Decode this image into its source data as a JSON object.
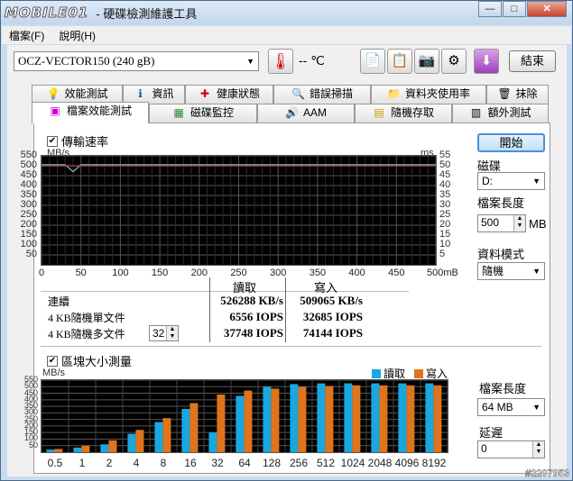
{
  "app": {
    "logo": "MOBILE01",
    "title": "- 硬碟檢測維護工具"
  },
  "window_buttons": {
    "minimize": "—",
    "maximize": "□",
    "close": "✕"
  },
  "menu": [
    {
      "label": "檔案(F)"
    },
    {
      "label": "說明(H)"
    }
  ],
  "toolbar": {
    "drive": "OCZ-VECTOR150 (240 gB)",
    "temperature": "-- ℃",
    "exit_label": "結束"
  },
  "tabs_row1": [
    {
      "label": "效能測試",
      "icon": "lightbulb-icon"
    },
    {
      "label": "資訊",
      "icon": "info-icon"
    },
    {
      "label": "健康狀態",
      "icon": "health-cross-icon"
    },
    {
      "label": "錯誤掃描",
      "icon": "magnifier-icon"
    },
    {
      "label": "資料夾使用率",
      "icon": "folder-icon"
    },
    {
      "label": "抹除",
      "icon": "trash-icon"
    }
  ],
  "tabs_row2": [
    {
      "label": "檔案效能測試",
      "icon": "file-benchmark-icon",
      "active": true
    },
    {
      "label": "磁碟監控",
      "icon": "monitor-icon"
    },
    {
      "label": "AAM",
      "icon": "speaker-icon"
    },
    {
      "label": "隨機存取",
      "icon": "random-access-icon"
    },
    {
      "label": "額外測試",
      "icon": "extra-test-icon"
    }
  ],
  "transfer": {
    "checkbox_label": "傳輸速率",
    "left_unit": "MB/s",
    "right_unit": "ms",
    "y_ticks": [
      "550",
      "500",
      "450",
      "400",
      "350",
      "300",
      "250",
      "200",
      "150",
      "100",
      "50"
    ],
    "y_ticks_right": [
      "55",
      "50",
      "45",
      "40",
      "35",
      "30",
      "25",
      "20",
      "15",
      "10",
      "5"
    ],
    "x_ticks": [
      "0",
      "50",
      "100",
      "150",
      "200",
      "250",
      "300",
      "350",
      "400",
      "450",
      "500mB"
    ]
  },
  "results": {
    "col_read": "讀取",
    "col_write": "寫入",
    "rows": [
      {
        "label": "連續",
        "read": "526288 KB/s",
        "write": "509065 KB/s"
      },
      {
        "label": "4 KB隨機單文件",
        "read": "6556 IOPS",
        "write": "32685 IOPS"
      },
      {
        "label": "4 KB隨機多文件",
        "read": "37748 IOPS",
        "write": "74144 IOPS"
      }
    ],
    "queue_depth": "32"
  },
  "block": {
    "checkbox_label": "區塊大小測量",
    "unit": "MB/s",
    "legend_read": "讀取",
    "legend_write": "寫入"
  },
  "side": {
    "start_label": "開始",
    "disk_label": "磁碟",
    "disk_value": "D:",
    "file_length_label": "檔案長度",
    "file_length_value": "500",
    "file_length_unit": "MB",
    "data_mode_label": "資料模式",
    "data_mode_value": "隨機",
    "block_file_length_label": "檔案長度",
    "block_file_length_value": "64 MB",
    "delay_label": "延遲",
    "delay_value": "0"
  },
  "watermark": "#2207953",
  "colors": {
    "read": "#1aa7e0",
    "write": "#e0741a",
    "line_read": "#7fb2d9",
    "line_write": "#c04040"
  },
  "chart_data": [
    {
      "type": "line",
      "title": "傳輸速率",
      "xlabel": "mB",
      "ylabel": "MB/s",
      "xlim": [
        0,
        500
      ],
      "ylim": [
        0,
        550
      ],
      "series": [
        {
          "name": "讀取",
          "values": [
            505,
            505,
            505,
            505,
            470,
            505,
            505,
            505,
            505,
            505,
            505,
            505,
            505,
            505,
            505,
            505,
            505,
            505,
            505,
            505,
            505,
            505,
            505,
            505,
            505,
            505,
            505,
            505,
            505,
            505,
            505,
            505,
            505,
            505,
            505,
            505,
            505,
            505,
            505,
            505,
            505,
            505,
            505,
            505,
            505,
            505,
            505,
            505,
            505,
            505,
            505
          ]
        },
        {
          "name": "寫入",
          "values": [
            500,
            500,
            500,
            500,
            500,
            500,
            500,
            500,
            500,
            500,
            500,
            500,
            500,
            500,
            500,
            500,
            500,
            500,
            500,
            500,
            500,
            500,
            500,
            500,
            500,
            500,
            500,
            500,
            500,
            500,
            500,
            500,
            500,
            500,
            500,
            500,
            500,
            500,
            500,
            500,
            500,
            500,
            500,
            500,
            500,
            500,
            500,
            500,
            500,
            500,
            500
          ]
        }
      ]
    },
    {
      "type": "bar",
      "title": "區塊大小測量",
      "ylabel": "MB/s",
      "ylim": [
        0,
        550
      ],
      "categories": [
        "0.5",
        "1",
        "2",
        "4",
        "8",
        "16",
        "32",
        "64",
        "128",
        "256",
        "512",
        "1024",
        "2048",
        "4096",
        "8192"
      ],
      "series": [
        {
          "name": "讀取",
          "values": [
            20,
            35,
            60,
            140,
            230,
            330,
            150,
            430,
            500,
            520,
            525,
            525,
            525,
            525,
            525
          ]
        },
        {
          "name": "寫入",
          "values": [
            25,
            50,
            90,
            170,
            260,
            375,
            440,
            470,
            485,
            500,
            505,
            510,
            510,
            510,
            510
          ]
        }
      ]
    }
  ]
}
